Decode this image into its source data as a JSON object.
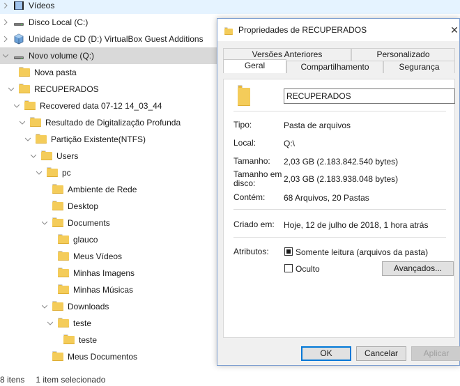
{
  "tree": [
    {
      "label": "Vídeos",
      "icon": "videos-icon",
      "chevron": "right",
      "indent": 0,
      "state": "hover"
    },
    {
      "label": "Disco Local (C:)",
      "icon": "drive-icon",
      "chevron": "right",
      "indent": 0
    },
    {
      "label": "Unidade de CD (D:) VirtualBox Guest Additions",
      "icon": "cd-drive-icon",
      "chevron": "right",
      "indent": 0
    },
    {
      "label": "Novo volume (Q:)",
      "icon": "drive-icon",
      "chevron": "down",
      "indent": 0,
      "state": "selected"
    },
    {
      "label": "Nova pasta",
      "icon": "folder-icon",
      "chevron": "none",
      "indent": 1
    },
    {
      "label": "RECUPERADOS",
      "icon": "folder-icon",
      "chevron": "down",
      "indent": 1
    },
    {
      "label": "Recovered data 07-12 14_03_44",
      "icon": "folder-icon",
      "chevron": "down",
      "indent": 2
    },
    {
      "label": "Resultado de Digitalização Profunda",
      "icon": "folder-icon",
      "chevron": "down",
      "indent": 3
    },
    {
      "label": "Partição Existente(NTFS)",
      "icon": "folder-icon",
      "chevron": "down",
      "indent": 4
    },
    {
      "label": "Users",
      "icon": "folder-icon",
      "chevron": "down",
      "indent": 5
    },
    {
      "label": "pc",
      "icon": "folder-icon",
      "chevron": "down",
      "indent": 6
    },
    {
      "label": "Ambiente de Rede",
      "icon": "folder-icon",
      "chevron": "none",
      "indent": 7
    },
    {
      "label": "Desktop",
      "icon": "folder-icon",
      "chevron": "none",
      "indent": 7
    },
    {
      "label": "Documents",
      "icon": "folder-icon",
      "chevron": "down",
      "indent": 7
    },
    {
      "label": "glauco",
      "icon": "folder-icon",
      "chevron": "none",
      "indent": 8
    },
    {
      "label": "Meus Vídeos",
      "icon": "folder-icon",
      "chevron": "none",
      "indent": 8
    },
    {
      "label": "Minhas Imagens",
      "icon": "folder-icon",
      "chevron": "none",
      "indent": 8
    },
    {
      "label": "Minhas Músicas",
      "icon": "folder-icon",
      "chevron": "none",
      "indent": 8
    },
    {
      "label": "Downloads",
      "icon": "folder-icon",
      "chevron": "down",
      "indent": 7
    },
    {
      "label": "teste",
      "icon": "folder-icon",
      "chevron": "down",
      "indent": 8
    },
    {
      "label": "teste",
      "icon": "folder-icon",
      "chevron": "none",
      "indent": 9
    },
    {
      "label": "Meus Documentos",
      "icon": "folder-icon",
      "chevron": "none",
      "indent": 7
    }
  ],
  "status": {
    "item_count": "8 itens",
    "selection": "1 item selecionado"
  },
  "dialog": {
    "title": "Propriedades de RECUPERADOS",
    "close_glyph": "✕",
    "tabs_back": [
      "Versões Anteriores",
      "Personalizado"
    ],
    "tabs_front": [
      "Geral",
      "Compartilhamento",
      "Segurança"
    ],
    "active_tab": "Geral",
    "name_value": "RECUPERADOS",
    "fields": {
      "tipo_label": "Tipo:",
      "tipo": "Pasta de arquivos",
      "local_label": "Local:",
      "local": "Q:\\",
      "tamanho_label": "Tamanho:",
      "tamanho": "2,03 GB (2.183.842.540 bytes)",
      "tamanho_disco_label": "Tamanho em disco:",
      "tamanho_disco": "2,03 GB (2.183.938.048 bytes)",
      "contem_label": "Contém:",
      "contem": "68 Arquivos, 20 Pastas",
      "criado_label": "Criado em:",
      "criado": "Hoje, 12 de julho de 2018, 1 hora atrás",
      "atributos_label": "Atributos:"
    },
    "attributes": {
      "readonly_label": "Somente leitura (arquivos da pasta)",
      "readonly_state": "indeterminate",
      "hidden_label": "Oculto",
      "hidden_state": "unchecked",
      "advanced_label": "Avançados..."
    },
    "buttons": {
      "ok": "OK",
      "cancel": "Cancelar",
      "apply": "Aplicar"
    }
  },
  "colors": {
    "folder": "#f4cc5a",
    "selected_row": "#d9d9d9",
    "hover_row": "#e5f3ff",
    "accent": "#0078d7"
  }
}
